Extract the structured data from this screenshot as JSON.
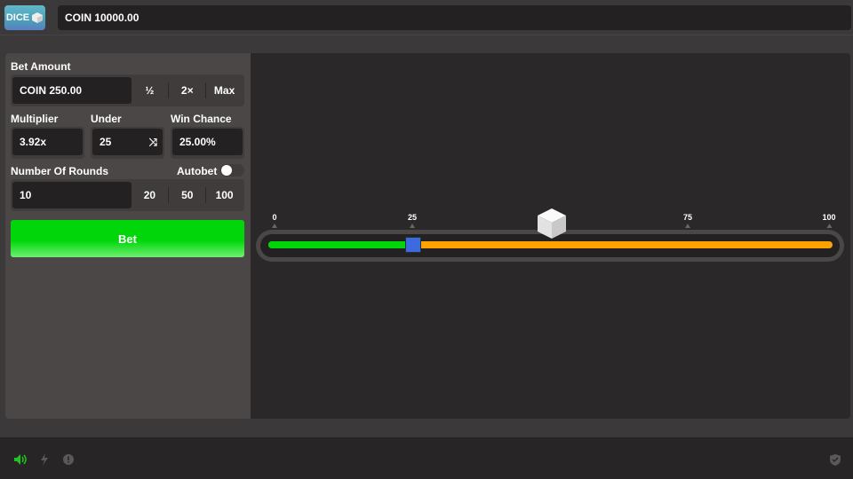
{
  "header": {
    "logo_text": "DICE",
    "balance": "COIN 10000.00"
  },
  "bet_amount": {
    "label": "Bet Amount",
    "value": "COIN 250.00",
    "half": "½",
    "double": "2×",
    "max": "Max"
  },
  "multiplier": {
    "label": "Multiplier",
    "value": "3.92x"
  },
  "under": {
    "label": "Under",
    "value": "25"
  },
  "win_chance": {
    "label": "Win Chance",
    "value": "25.00%"
  },
  "rounds": {
    "label": "Number Of Rounds",
    "value": "10",
    "options": [
      "20",
      "50",
      "100"
    ]
  },
  "autobet": {
    "label": "Autobet",
    "enabled": false
  },
  "bet_button": "Bet",
  "slider": {
    "ticks": [
      "0",
      "25",
      "75",
      "100"
    ],
    "value": 25,
    "min": 0,
    "max": 100,
    "result_marker": 50,
    "win_color": "#00d60a",
    "lose_color": "#ffa200",
    "handle_color": "#3d6ae0"
  }
}
